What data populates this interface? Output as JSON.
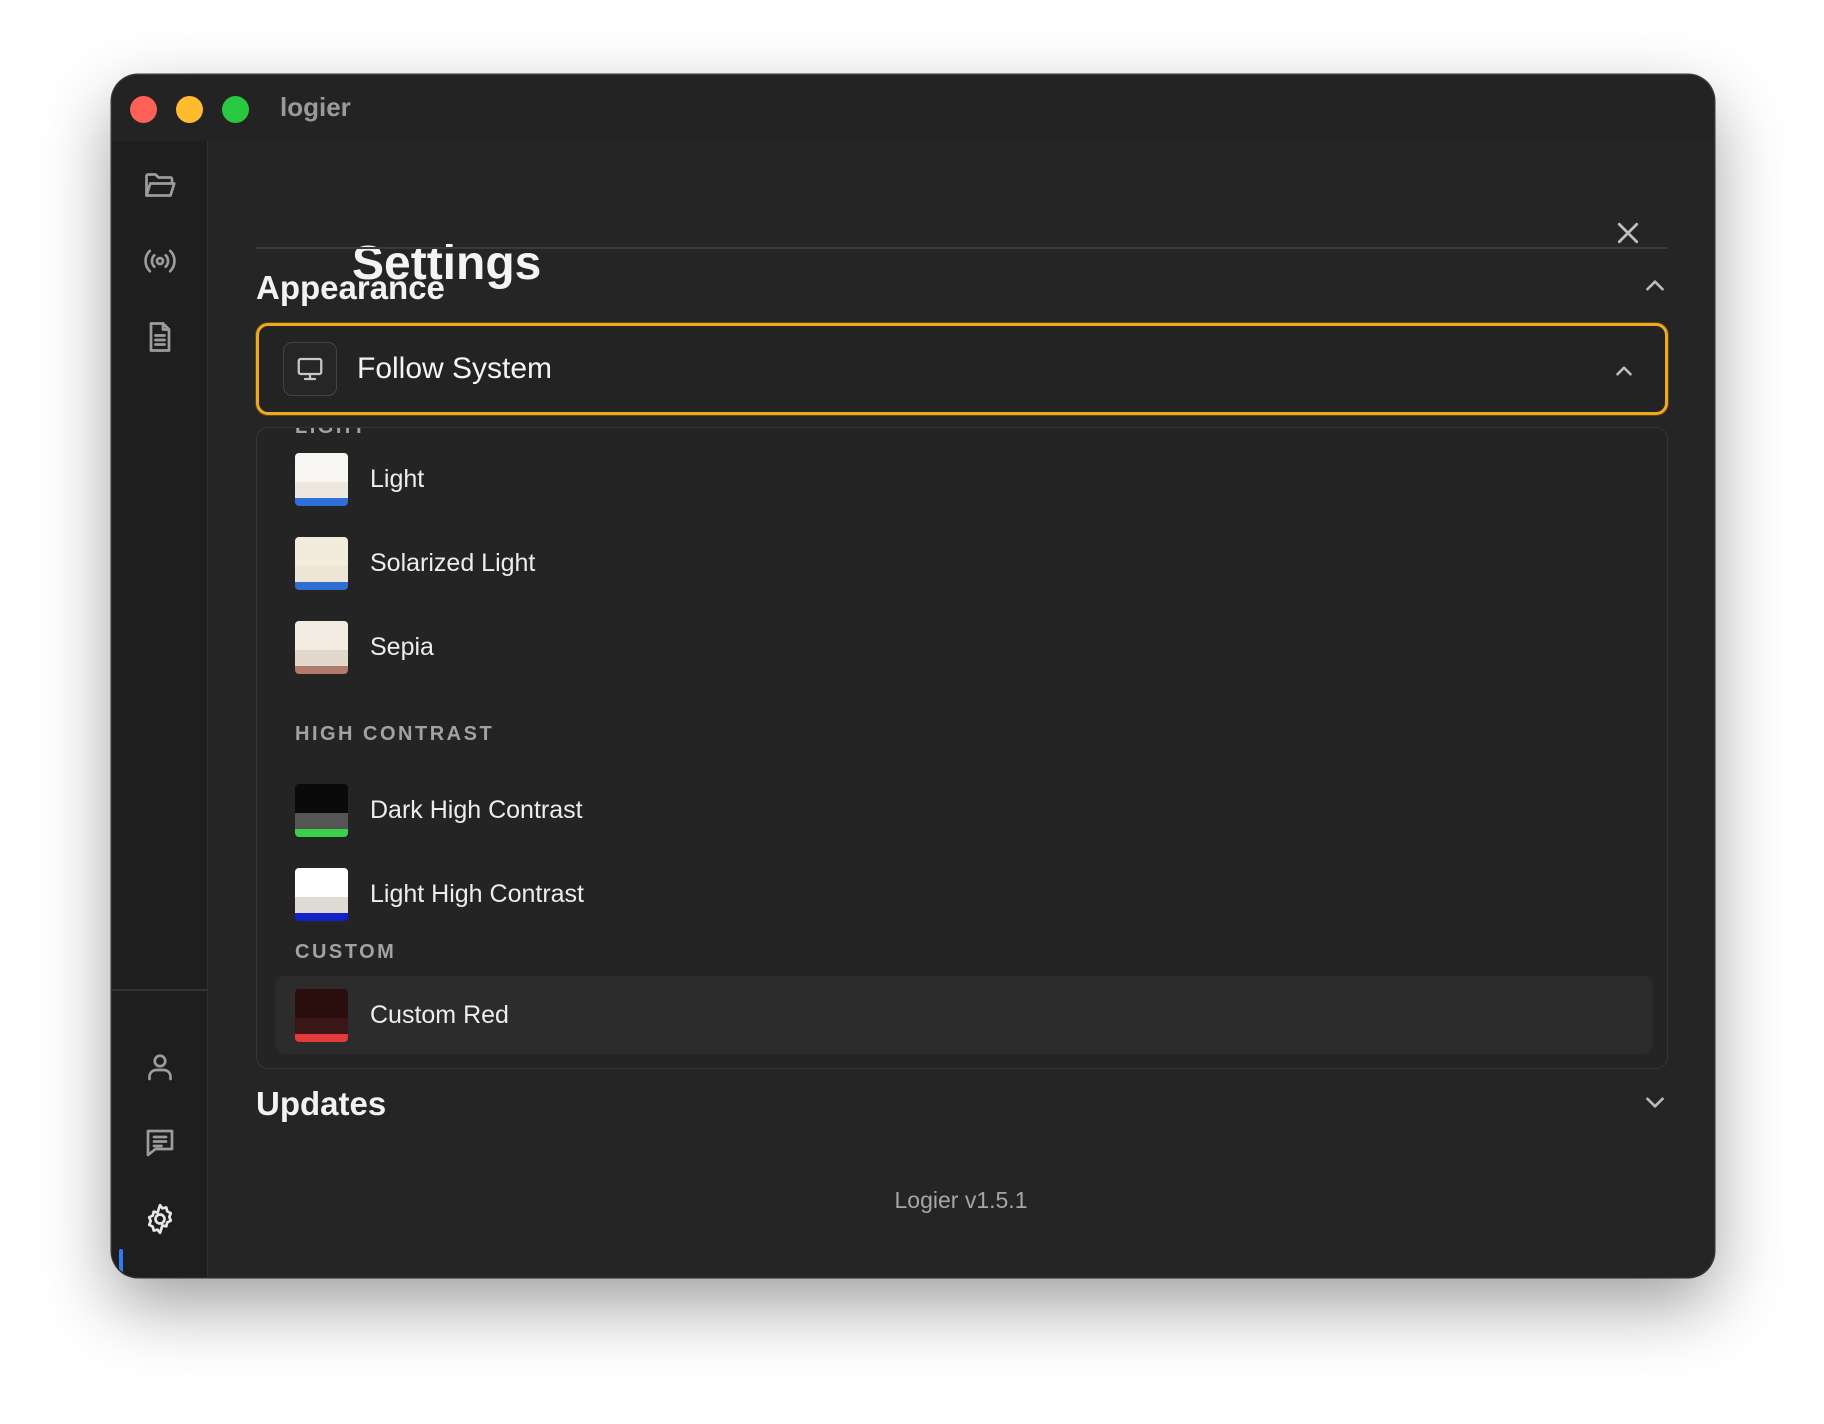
{
  "window": {
    "title": "logier"
  },
  "sidebar": {
    "top_items": [
      {
        "icon": "folder-open-icon"
      },
      {
        "icon": "broadcast-icon"
      },
      {
        "icon": "document-icon"
      }
    ],
    "bottom_items": [
      {
        "icon": "user-icon"
      },
      {
        "icon": "chat-icon"
      },
      {
        "icon": "gear-icon",
        "active": true
      }
    ],
    "active_accent": "#2e7bf6"
  },
  "settings": {
    "title": "Settings",
    "appearance": {
      "title": "Appearance",
      "expanded": true,
      "theme_select": {
        "value": "Follow System",
        "icon": "monitor-icon",
        "open": true,
        "focus_color": "#f0a91b"
      },
      "dropdown": {
        "groups": [
          {
            "label": "LIGHT",
            "options": [
              {
                "label": "Light",
                "swatch": {
                  "top": "#f8f6f3",
                  "mid": "#ece7df",
                  "bar": "#2e6fd8"
                }
              },
              {
                "label": "Solarized Light",
                "swatch": {
                  "top": "#f3ecdd",
                  "mid": "#ede6d4",
                  "bar": "#2f6fd0"
                }
              },
              {
                "label": "Sepia",
                "swatch": {
                  "top": "#f3ece2",
                  "mid": "#e2d9cc",
                  "bar": "#b07a6c"
                }
              }
            ]
          },
          {
            "label": "HIGH CONTRAST",
            "options": [
              {
                "label": "Dark High Contrast",
                "swatch": {
                  "top": "#0a0a0a",
                  "mid": "#555555",
                  "bar": "#39d24a"
                }
              },
              {
                "label": "Light High Contrast",
                "swatch": {
                  "top": "#ffffff",
                  "mid": "#dedbd5",
                  "bar": "#1022c8"
                }
              }
            ]
          },
          {
            "label": "CUSTOM",
            "options": [
              {
                "label": "Custom Red",
                "hover": true,
                "swatch": {
                  "top": "#2a0e0e",
                  "mid": "#3a1616",
                  "bar": "#e23b3b"
                }
              }
            ]
          }
        ]
      }
    },
    "updates": {
      "title": "Updates",
      "expanded": false
    },
    "version": "Logier v1.5.1"
  }
}
